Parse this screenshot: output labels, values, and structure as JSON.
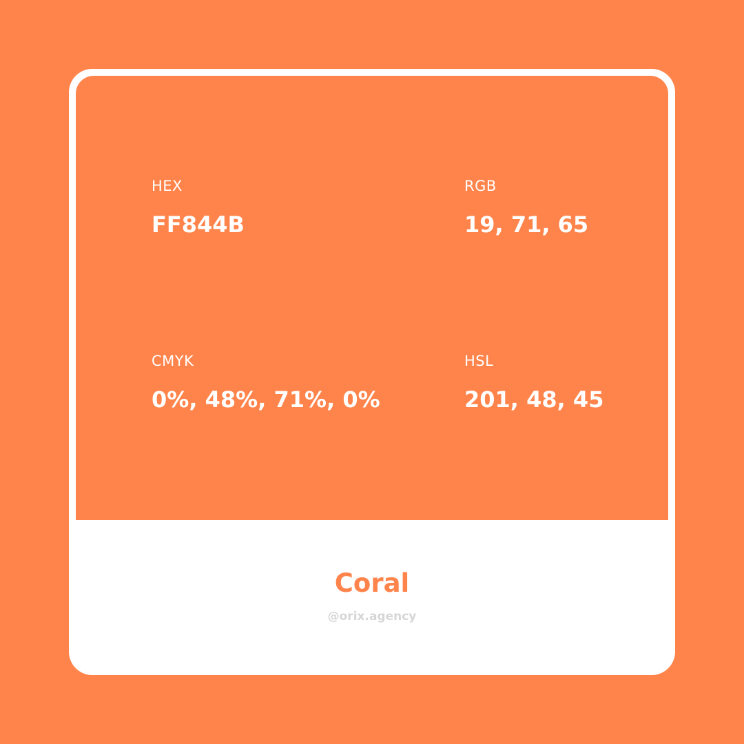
{
  "colors": {
    "background": "#FF844B",
    "card": "#FFFFFF",
    "handle_text": "#D6D6D6"
  },
  "specs": {
    "hex": {
      "label": "HEX",
      "value": "FF844B"
    },
    "rgb": {
      "label": "RGB",
      "value": "19, 71, 65"
    },
    "cmyk": {
      "label": "CMYK",
      "value": "0%, 48%, 71%, 0%"
    },
    "hsl": {
      "label": "HSL",
      "value": "201, 48, 45"
    }
  },
  "footer": {
    "color_name": "Coral",
    "handle": "@orix.agency"
  }
}
